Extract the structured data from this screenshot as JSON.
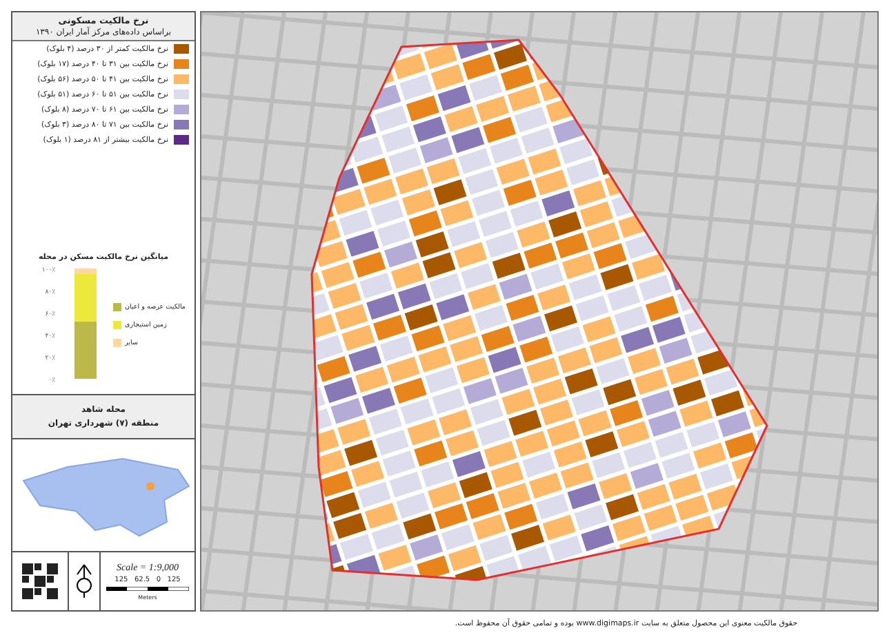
{
  "legend": {
    "title": "نرخ مالکیت مسکونی",
    "subtitle": "براساس داده‌های مرکز آمار ایران ۱۳۹۰",
    "items": [
      {
        "label": "نرخ مالکیت کمتر از ۳۰ درصد (۴ بلوک)",
        "color": "#a85800"
      },
      {
        "label": "نرخ مالکیت بین ۳۱ تا ۴۰ درصد (۱۷ بلوک)",
        "color": "#e8841c"
      },
      {
        "label": "نرخ مالکیت بین ۴۱ تا ۵۰ درصد (۵۶ بلوک)",
        "color": "#fdb868"
      },
      {
        "label": "نرخ مالکیت بین ۵۱ تا ۶۰ درصد (۵۱ بلوک)",
        "color": "#dcdcec"
      },
      {
        "label": "نرخ مالکیت بین ۶۱ تا ۷۰ درصد (۸ بلوک)",
        "color": "#b4acd6"
      },
      {
        "label": "نرخ مالکیت بین ۷۱ تا ۸۰ درصد (۳ بلوک)",
        "color": "#8878b6"
      },
      {
        "label": "نرخ مالکیت بیشتر از ۸۱ درصد (۱ بلوک)",
        "color": "#5a2a86"
      }
    ]
  },
  "chart": {
    "chart_data": {
      "type": "bar",
      "stacked": true,
      "legend": "right",
      "title": "میانگین نرخ مالکیت مسکن در محله",
      "ylim": [
        0,
        100
      ],
      "yticks": [
        {
          "value": 0,
          "label": "۰٪"
        },
        {
          "value": 20,
          "label": "۲۰٪"
        },
        {
          "value": 40,
          "label": "۴۰٪"
        },
        {
          "value": 60,
          "label": "۶۰٪"
        },
        {
          "value": 80,
          "label": "۸۰٪"
        },
        {
          "value": 100,
          "label": "۱۰۰٪"
        }
      ],
      "series": [
        {
          "name": "مالکیت عرصه و اعیان",
          "color": "#bcb84a",
          "values": [
            52
          ]
        },
        {
          "name": "زمین استیجاری",
          "color": "#ece83c",
          "values": [
            43
          ]
        },
        {
          "name": "سایر",
          "color": "#fdd9a0",
          "values": [
            5
          ]
        }
      ]
    }
  },
  "location": {
    "name": "محله شاهد",
    "district": "منطقه (۷) شهرداری تهران"
  },
  "scale": {
    "text": "Scale = 1:9,000",
    "tick_labels": "125   62.5   0   125",
    "unit": "Meters"
  },
  "footer": "حقوق مالکیت معنوی این محصول متعلق به سایت www.digimaps.ir بوده و تمامی حقوق آن محفوظ است."
}
